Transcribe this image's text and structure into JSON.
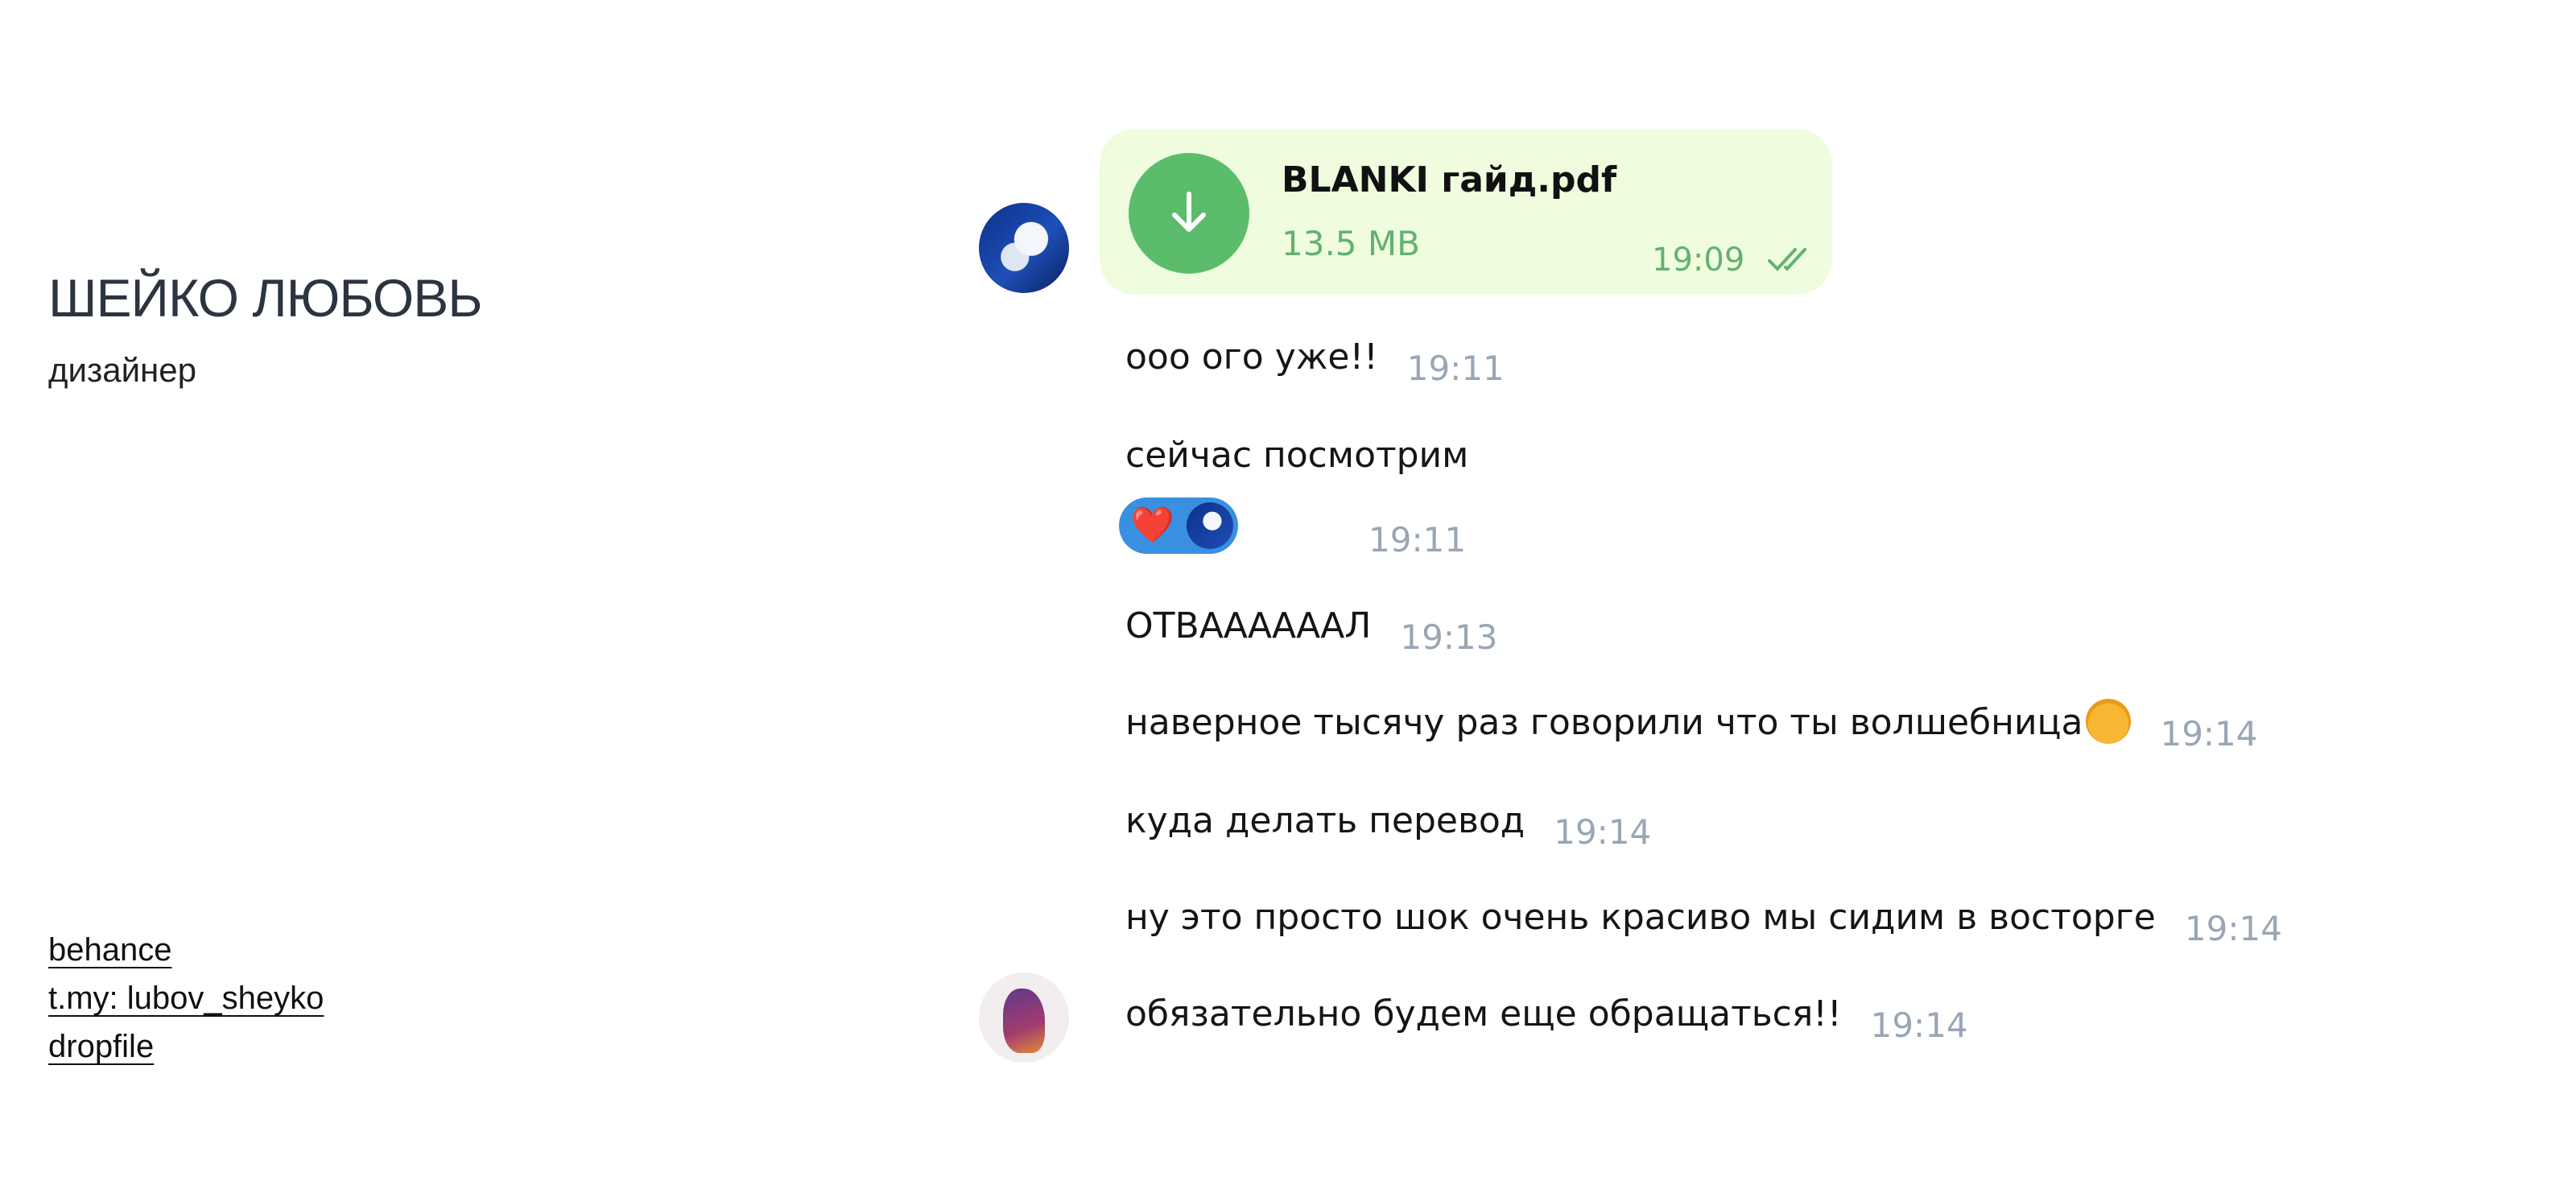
{
  "profile": {
    "name": "ШЕЙКО ЛЮБОВЬ",
    "role": "дизайнер"
  },
  "links": [
    "behance",
    "t.my: lubov_sheyko",
    "dropfile"
  ],
  "file_message": {
    "name": "BLANKI гайд.pdf",
    "size": "13.5 MB",
    "time": "19:09",
    "status_icon": "double-check-icon",
    "accent": "#5bbd6b",
    "bubble_color": "#effdde"
  },
  "messages": [
    {
      "text": "ооо ого уже!!",
      "time": "19:11"
    },
    {
      "text": "сейчас посмотрим",
      "time": "19:11",
      "reaction": "❤️"
    },
    {
      "text": "ОТВААААААЛ",
      "time": "19:13"
    },
    {
      "text": "наверное тысячу раз говорили что ты волшебница",
      "emoji": "shushing-face-emoji",
      "time": "19:14"
    },
    {
      "text": "куда делать перевод",
      "time": "19:14"
    },
    {
      "text": "ну это просто шок очень красиво мы сидим в восторге",
      "time": "19:14"
    },
    {
      "text": "обязательно будем еще обращаться!!",
      "time": "19:14"
    }
  ]
}
